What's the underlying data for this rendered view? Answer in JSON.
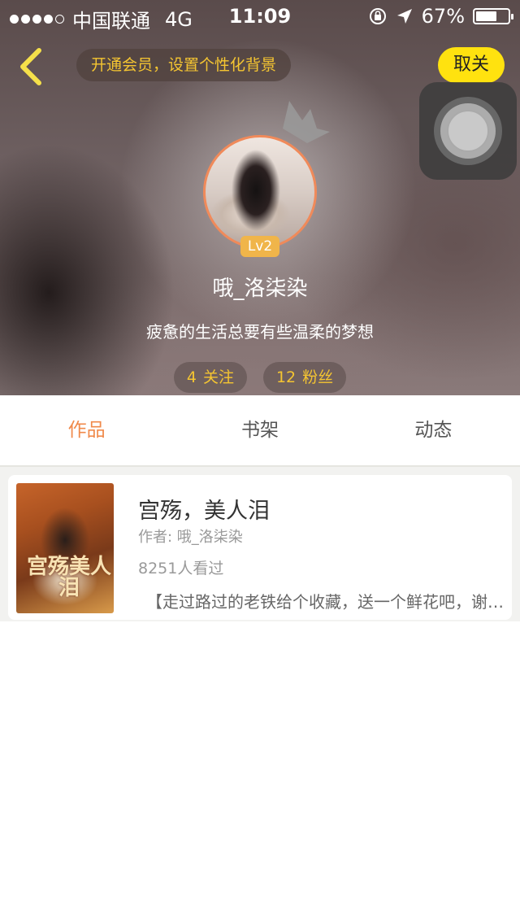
{
  "status_bar": {
    "carrier": "中国联通",
    "network": "4G",
    "time": "11:09",
    "battery_percent": "67%",
    "battery_level": 0.67
  },
  "nav": {
    "vip_banner": "开通会员，设置个性化背景",
    "follow_button": "取关"
  },
  "profile": {
    "level": "Lv2",
    "username": "哦_洛柒染",
    "motto": "疲惫的生活总要有些温柔的梦想",
    "following_count": "4",
    "following_label": "关注",
    "fans_count": "12",
    "fans_label": "粉丝"
  },
  "tabs": [
    {
      "label": "作品",
      "active": true
    },
    {
      "label": "书架",
      "active": false
    },
    {
      "label": "动态",
      "active": false
    }
  ],
  "books": [
    {
      "title": "宫殇，美人泪",
      "author": "作者: 哦_洛柒染",
      "views": "8251人看过",
      "description": "【走过路过的老铁给个收藏，送一个鲜花吧，谢谢】",
      "cover_text": "宫殇美人泪"
    }
  ],
  "colors": {
    "accent": "#f08a4b",
    "follow_button": "#ffe20f",
    "stat_text": "#f5c531",
    "avatar_border": "#f08a5a",
    "level_badge": "#f0b54a"
  },
  "icons": [
    "back-icon",
    "crown-icon",
    "location-arrow-icon",
    "rotation-lock-icon"
  ]
}
